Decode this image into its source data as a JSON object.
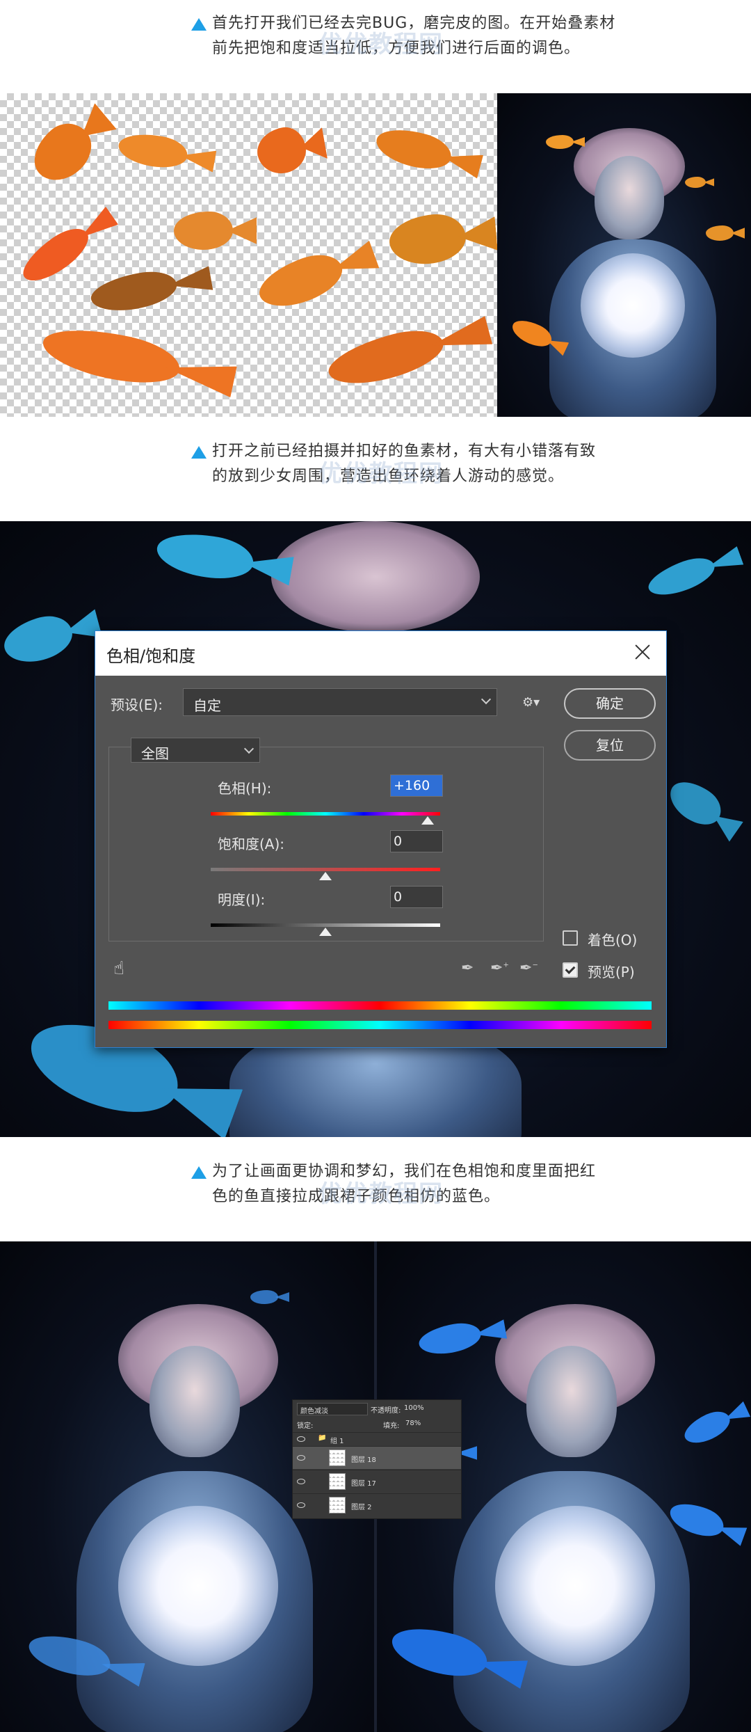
{
  "captions": [
    {
      "lines": [
        "首先打开我们已经去完BUG，磨完皮的图。在开始叠素材",
        "前先把饱和度适当拉低，方便我们进行后面的调色。"
      ]
    },
    {
      "lines": [
        "打开之前已经拍摄并扣好的鱼素材，有大有小错落有致",
        "的放到少女周围，营造出鱼环绕着人游动的感觉。"
      ]
    },
    {
      "lines": [
        "为了让画面更协调和梦幻，我们在色相饱和度里面把红",
        "色的鱼直接拉成跟裙子颜色相仿的蓝色。"
      ]
    }
  ],
  "watermark": "优优教程网",
  "colors": {
    "accent": "#1e9fe6",
    "dialog_bg": "#535353",
    "dialog_border": "#2d7fd1"
  },
  "dialog": {
    "title": "色相/饱和度",
    "preset_label": "预设(E):",
    "preset_value": "自定",
    "channel_value": "全图",
    "ok_label": "确定",
    "reset_label": "复位",
    "hue_label": "色相(H):",
    "hue_value": "+160",
    "hue_level": 0.944,
    "saturation_label": "饱和度(A):",
    "saturation_value": "0",
    "saturation_level": 0.5,
    "lightness_label": "明度(I):",
    "lightness_value": "0",
    "lightness_level": 0.5,
    "colorize_label": "着色(O)",
    "colorize_checked": false,
    "preview_label": "预览(P)",
    "preview_checked": true,
    "icons": [
      "gear-icon",
      "hand-target-icon",
      "eyedropper-icon",
      "eyedropper-add-icon",
      "eyedropper-subtract-icon"
    ]
  },
  "layers_panel": {
    "blend_mode": "颜色减淡",
    "opacity_label": "不透明度:",
    "opacity_value": "100%",
    "lock_label": "锁定:",
    "fill_label": "填充:",
    "fill_value": "78%",
    "group_name": "组 1",
    "layers": [
      "图层 18",
      "图层 17",
      "图层 2"
    ]
  }
}
